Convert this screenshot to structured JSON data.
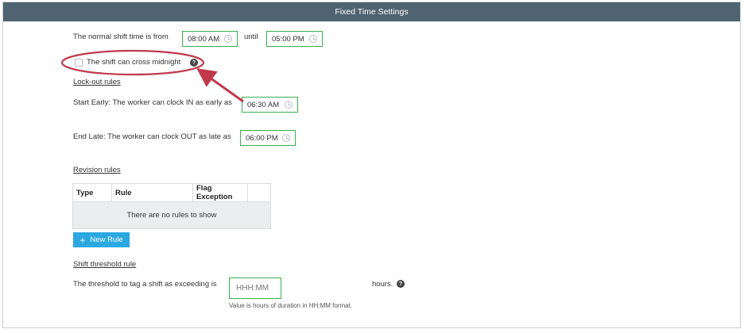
{
  "header": {
    "title": "Fixed Time Settings"
  },
  "normal_shift": {
    "label": "The normal shift time is from",
    "start": "08:00 AM",
    "until_label": "until",
    "end": "05:00 PM"
  },
  "cross_midnight": {
    "label": "The shift can cross midnight",
    "checked": false,
    "help": "?"
  },
  "lockout": {
    "title": "Lock-out rules",
    "start_early_label": "Start Early: The worker can clock IN as early as",
    "start_early_value": "06:30 AM",
    "end_late_label": "End Late: The worker can clock OUT as late as",
    "end_late_value": "06:00 PM"
  },
  "revision": {
    "title": "Revision rules",
    "columns": [
      "Type",
      "Rule",
      "Flag Exception",
      ""
    ],
    "empty_message": "There are no rules to show",
    "new_rule_icon": "+",
    "new_rule_label": "New Rule"
  },
  "threshold": {
    "title": "Shift threshold rule",
    "label": "The threshold to tag a shift as exceeding is",
    "placeholder": "HHH:MM",
    "unit": "hours.",
    "help": "?",
    "hint": "Value is hours of duration in HH:MM format."
  },
  "colors": {
    "header": "#4f6370",
    "accent": "#2aa8df",
    "field_border": "#3cae4f",
    "annotation": "#c0394b"
  }
}
